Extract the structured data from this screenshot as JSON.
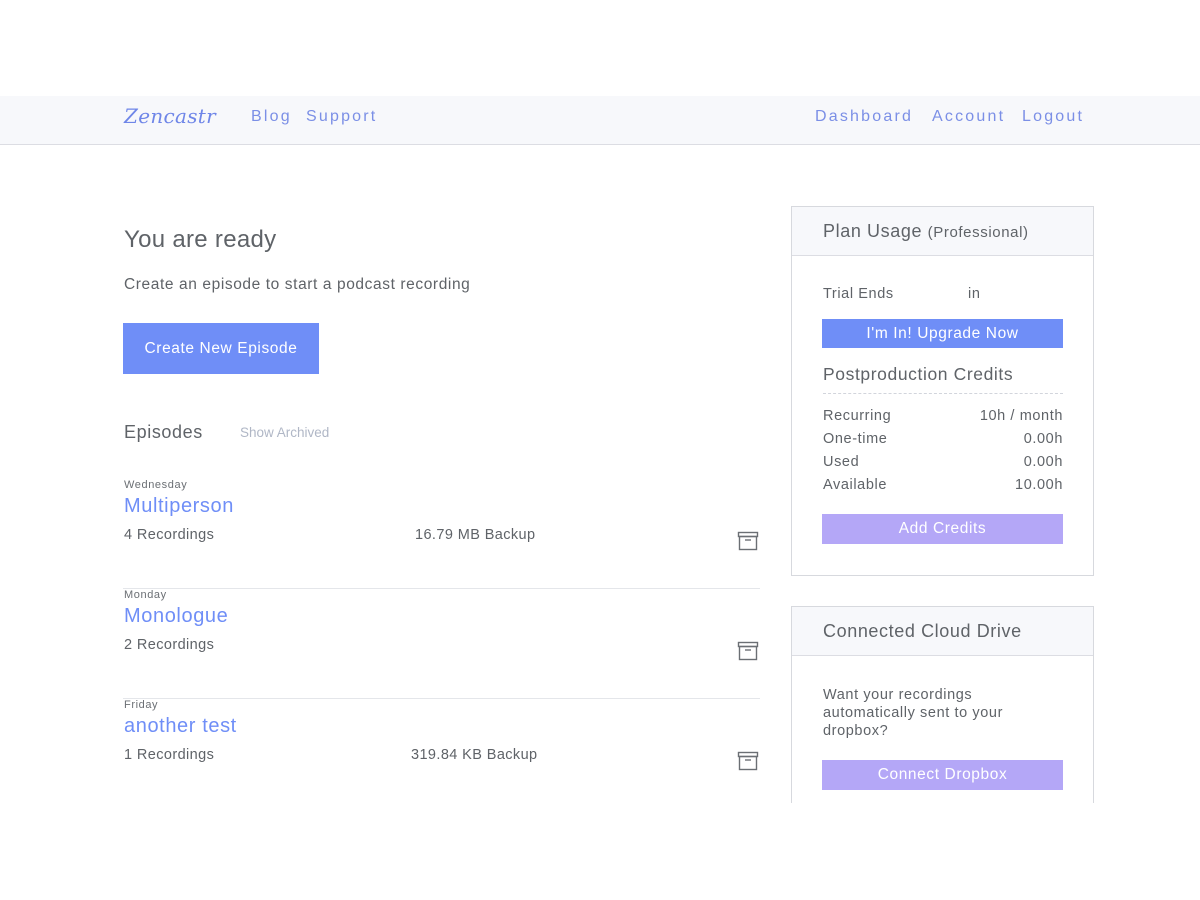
{
  "nav": {
    "logo": "Zencastr",
    "left_links": [
      "Blog",
      "Support"
    ],
    "right_links": [
      "Dashboard",
      "Account",
      "Logout"
    ]
  },
  "main": {
    "title": "You are ready",
    "subtitle": "Create an episode to start a podcast recording",
    "create_button": "Create New Episode",
    "episodes_heading": "Episodes",
    "show_archived": "Show Archived",
    "episodes": [
      {
        "day": "Wednesday",
        "name": "Multiperson",
        "recordings": "4 Recordings",
        "backup": "16.79 MB Backup"
      },
      {
        "day": "Monday",
        "name": "Monologue",
        "recordings": "2 Recordings",
        "backup": ""
      },
      {
        "day": "Friday",
        "name": "another test",
        "recordings": "1 Recordings",
        "backup": "319.84 KB Backup"
      }
    ]
  },
  "plan": {
    "heading": "Plan Usage",
    "plan_name": "(Professional)",
    "trial_label": "Trial Ends",
    "trial_value": "in",
    "upgrade_button": "I'm In! Upgrade Now",
    "credits_heading": "Postproduction Credits",
    "credits": [
      {
        "label": "Recurring",
        "value": "10h / month"
      },
      {
        "label": "One-time",
        "value": "0.00h"
      },
      {
        "label": "Used",
        "value": "0.00h"
      },
      {
        "label": "Available",
        "value": "10.00h"
      }
    ],
    "add_credits_button": "Add Credits"
  },
  "cloud": {
    "heading": "Connected Cloud Drive",
    "text": "Want your recordings automatically sent to your dropbox?",
    "connect_button": "Connect Dropbox"
  },
  "colors": {
    "accent": "#6f8ef7",
    "secondary_button": "#b4a7f7",
    "nav_link": "#7b8fe6"
  }
}
